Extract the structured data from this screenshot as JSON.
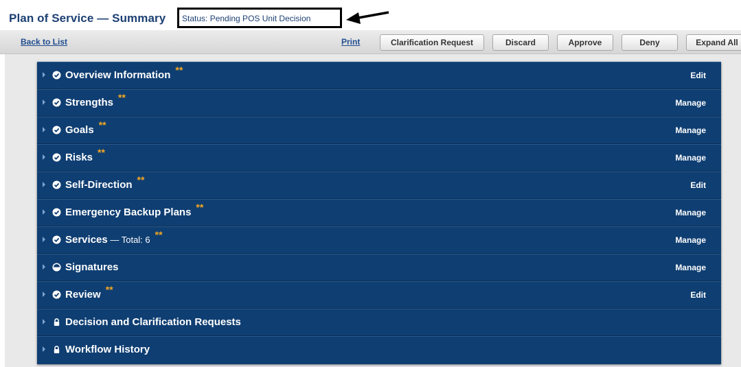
{
  "header": {
    "title": "Plan of Service — Summary",
    "status": "Status: Pending POS Unit Decision"
  },
  "toolbar": {
    "back_label": "Back to List",
    "print_label": "Print",
    "buttons": [
      "Clarification Request",
      "Discard",
      "Approve",
      "Deny",
      "Expand All"
    ]
  },
  "sections": [
    {
      "label": "Overview Information",
      "sub": "",
      "stars": "**",
      "icon": "check-circle-icon",
      "action": "Edit"
    },
    {
      "label": "Strengths",
      "sub": "",
      "stars": "**",
      "icon": "check-circle-icon",
      "action": "Manage"
    },
    {
      "label": "Goals",
      "sub": "",
      "stars": "**",
      "icon": "check-circle-icon",
      "action": "Manage"
    },
    {
      "label": "Risks",
      "sub": "",
      "stars": "**",
      "icon": "check-circle-icon",
      "action": "Manage"
    },
    {
      "label": "Self-Direction",
      "sub": "",
      "stars": "**",
      "icon": "check-circle-icon",
      "action": "Edit"
    },
    {
      "label": "Emergency Backup Plans",
      "sub": "",
      "stars": "**",
      "icon": "check-circle-icon",
      "action": "Manage"
    },
    {
      "label": "Services",
      "sub": " — Total: 6",
      "stars": "**",
      "icon": "check-circle-icon",
      "action": "Manage"
    },
    {
      "label": "Signatures",
      "sub": "",
      "stars": "",
      "icon": "half-circle-icon",
      "action": "Manage"
    },
    {
      "label": "Review",
      "sub": "",
      "stars": "**",
      "icon": "check-circle-icon",
      "action": "Edit"
    },
    {
      "label": "Decision and Clarification Requests",
      "sub": "",
      "stars": "",
      "icon": "lock-icon",
      "action": ""
    },
    {
      "label": "Workflow History",
      "sub": "",
      "stars": "",
      "icon": "lock-icon",
      "action": ""
    }
  ],
  "colors": {
    "panel": "#0f3e72",
    "title": "#1c3f73",
    "stars": "#f4a820",
    "link": "#1f4d8f"
  }
}
